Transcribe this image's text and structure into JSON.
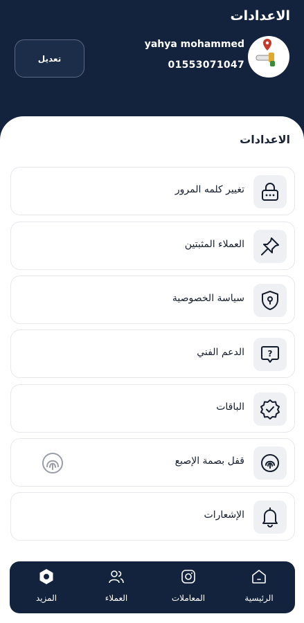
{
  "header": {
    "title": "الاعدادات",
    "user_name": "yahya mohammed",
    "user_phone": "01553071047",
    "edit_label": "تعديل"
  },
  "settings": {
    "section_title": "الاعدادات",
    "items": [
      {
        "label": "تغيير كلمه المرور",
        "icon": "lock-icon"
      },
      {
        "label": "العملاء المثبتين",
        "icon": "pin-icon"
      },
      {
        "label": "سياسة الخصوصية",
        "icon": "shield-icon"
      },
      {
        "label": "الدعم الفني",
        "icon": "help-chat-icon"
      },
      {
        "label": "الباقات",
        "icon": "badge-check-icon"
      },
      {
        "label": "قفل بصمة الإصبع",
        "icon": "fingerprint-icon"
      },
      {
        "label": "الإشعارات",
        "icon": "bell-icon"
      }
    ]
  },
  "bottom_nav": {
    "items": [
      {
        "label": "الرئيسية",
        "icon": "home-icon"
      },
      {
        "label": "المعاملات",
        "icon": "transactions-icon"
      },
      {
        "label": "العملاء",
        "icon": "users-icon"
      },
      {
        "label": "المزيد",
        "icon": "more-hexagon-icon"
      }
    ],
    "active_item": "المزيد"
  },
  "colors": {
    "primary": "#13233e",
    "card_icon_bg": "#eef0f3",
    "text": "#141c2b"
  }
}
